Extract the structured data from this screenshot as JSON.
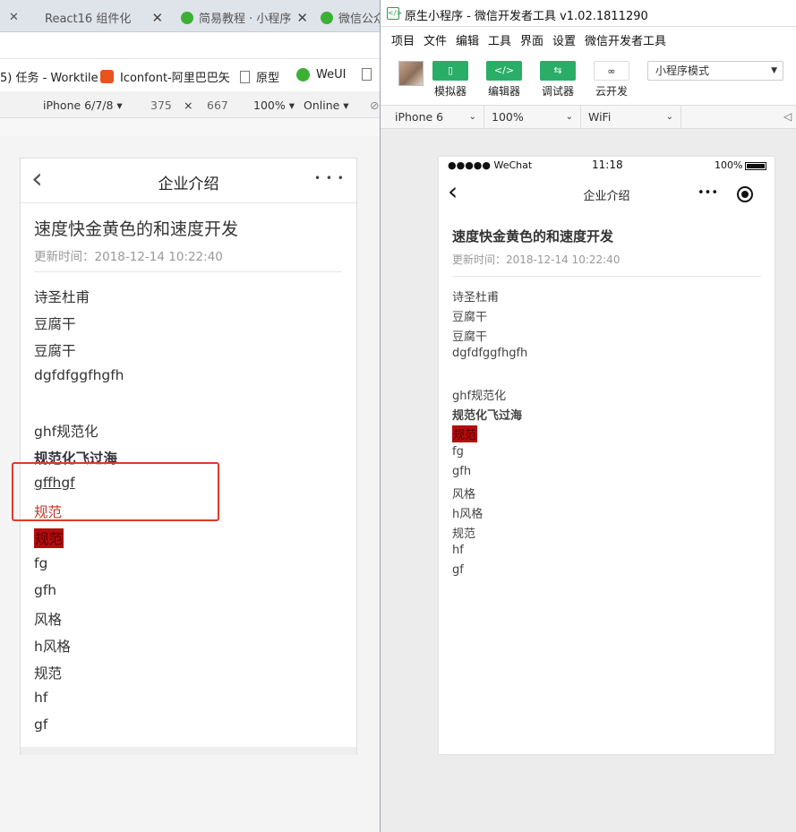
{
  "browser": {
    "tabs": [
      {
        "title": "React16 组件化 　",
        "close": "✕"
      },
      {
        "title": "简易教程 · 小程序",
        "close": "✕"
      },
      {
        "title": "微信公众",
        "close": ""
      }
    ],
    "first_tab_close": "✕",
    "bookmarks": [
      "5) 任务 - Worktile",
      "Iconfont-阿里巴巴矢",
      "原型",
      "WeUI"
    ],
    "device_toolbar": {
      "device": "iPhone 6/7/8",
      "width": "375",
      "times": "×",
      "height": "667",
      "zoom": "100%",
      "network": "Online"
    }
  },
  "left_page": {
    "nav_title": "企业介绍",
    "nav_back": "‹",
    "nav_more": "• • •",
    "article_title": "速度快金黄色的和速度开发",
    "updated": "更新时间：2018-12-14 10:22:40",
    "lines": [
      {
        "text": "诗圣杜甫",
        "style": "normal"
      },
      {
        "text": "豆腐干",
        "style": "normal"
      },
      {
        "text": "豆腐干",
        "style": "normal"
      },
      {
        "text": "dgfdfggfhgfh",
        "style": "normal"
      },
      {
        "text": "",
        "style": "blank"
      },
      {
        "text": "ghf规范化",
        "style": "normal"
      },
      {
        "text": "规范化飞过海",
        "style": "bold"
      },
      {
        "text": "gffhgf ",
        "style": "underline"
      },
      {
        "text": "规范",
        "style": "red"
      },
      {
        "text": "规范",
        "style": "highlight"
      },
      {
        "text": "fg",
        "style": "normal"
      },
      {
        "text": "gfh",
        "style": "normal"
      },
      {
        "text": "风格",
        "style": "normal"
      },
      {
        "text": "h风格",
        "style": "normal"
      },
      {
        "text": "规范",
        "style": "normal"
      },
      {
        "text": "hf",
        "style": "normal"
      },
      {
        "text": "gf",
        "style": "normal"
      }
    ]
  },
  "devtools": {
    "window_title": "原生小程序 - 微信开发者工具 v1.02.1811290",
    "menu": [
      "项目",
      "文件",
      "编辑",
      "工具",
      "界面",
      "设置",
      "微信开发者工具"
    ],
    "toolbar": [
      {
        "label": "模拟器",
        "icon": "phone-icon"
      },
      {
        "label": "编辑器",
        "icon": "code-icon"
      },
      {
        "label": "调试器",
        "icon": "debug-icon"
      },
      {
        "label": "云开发",
        "icon": "cloud-link-icon"
      }
    ],
    "mode": "小程序模式",
    "sim": {
      "device": "iPhone 6",
      "zoom": "100%",
      "network": "WiFi"
    },
    "accent": "#2aae67"
  },
  "right_page": {
    "status_carrier": "●●●●● WeChat",
    "status_time": "11:18",
    "status_battery": "100%",
    "nav_title": "企业介绍",
    "nav_back": "‹",
    "nav_more": "•••",
    "article_title": "速度快金黄色的和速度开发",
    "updated": "更新时间：2018-12-14 10:22:40",
    "lines": [
      {
        "text": "诗圣杜甫",
        "style": "normal"
      },
      {
        "text": "豆腐干",
        "style": "normal"
      },
      {
        "text": "豆腐干",
        "style": "normal"
      },
      {
        "text": "dgfdfggfhgfh",
        "style": "normal"
      },
      {
        "text": "",
        "style": "blank"
      },
      {
        "text": "ghf规范化",
        "style": "normal"
      },
      {
        "text": "规范化飞过海",
        "style": "bold"
      },
      {
        "text": "规范",
        "style": "highlight"
      },
      {
        "text": "fg",
        "style": "normal"
      },
      {
        "text": "gfh",
        "style": "normal"
      },
      {
        "text": "风格",
        "style": "normal"
      },
      {
        "text": "h风格",
        "style": "normal"
      },
      {
        "text": "规范",
        "style": "normal"
      },
      {
        "text": "hf",
        "style": "normal"
      },
      {
        "text": "gf",
        "style": "normal"
      }
    ]
  },
  "colors": {
    "red_text": "#c0392b",
    "highlight_bg": "#b30d0d",
    "highlight_text": "#5a0000",
    "annotation_box": "#e0392b"
  }
}
